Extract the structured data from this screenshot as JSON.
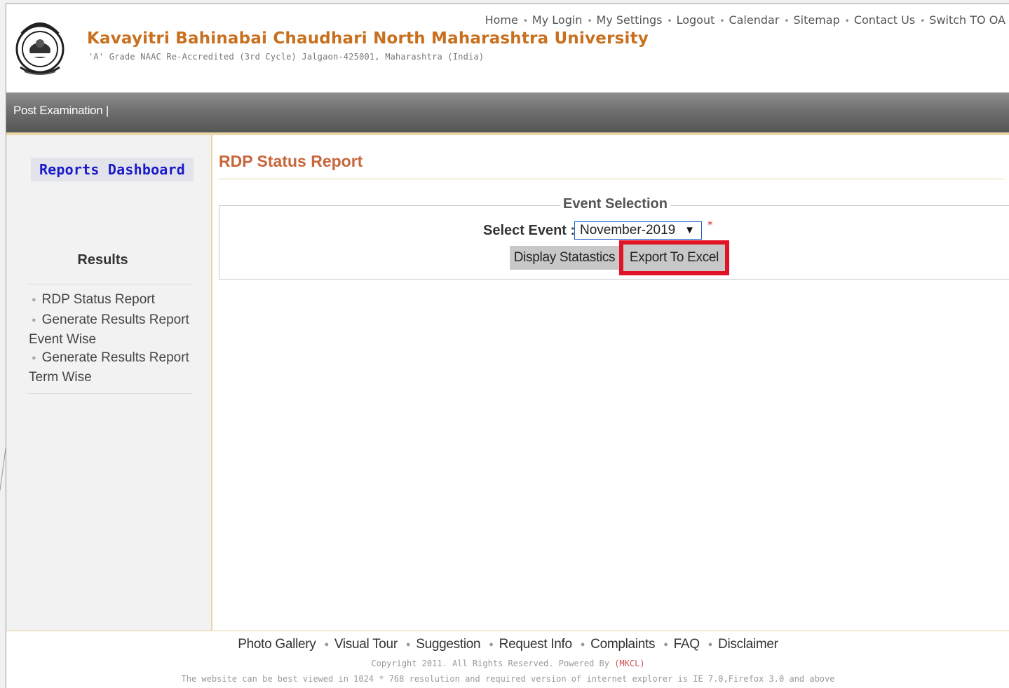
{
  "header": {
    "university_name": "Kavayitri Bahinabai Chaudhari North Maharashtra University",
    "subtitle": "'A' Grade NAAC Re-Accredited (3rd Cycle) Jalgaon-425001, Maharashtra (India)",
    "top_links": [
      "Home",
      "My Login",
      "My Settings",
      "Logout",
      "Calendar",
      "Sitemap",
      "Contact Us",
      "Switch TO OA"
    ],
    "logo_icon": "university-emblem-icon"
  },
  "nav": {
    "item": "Post Examination |"
  },
  "sidebar": {
    "dashboard_label": "Reports Dashboard",
    "section_title": "Results",
    "items": [
      {
        "label": "RDP Status Report"
      },
      {
        "label": "Generate Results Report Event Wise"
      },
      {
        "label": "Generate Results Report Term Wise"
      }
    ]
  },
  "main": {
    "title": "RDP Status Report",
    "legend": "Event Selection",
    "select_label": "Select Event :",
    "selected_event": "November-2019",
    "required_mark": "*",
    "display_button": "Display Statastics",
    "export_button": "Export To Excel"
  },
  "footer": {
    "links": [
      "Photo Gallery",
      "Visual Tour",
      "Suggestion",
      "Request Info",
      "Complaints",
      "FAQ",
      "Disclaimer"
    ],
    "copyright_prefix": "Copyright 2011. All Rights Reserved. Powered By ",
    "copyright_brand": "(MKCL)",
    "note": "The website can be best viewed in 1024 * 768 resolution and required version of internet explorer is IE 7.0,Firefox 3.0 and above"
  },
  "colors": {
    "university_name": "#c8701e",
    "page_title": "#c8653a",
    "dashboard_text": "#1a1ac8",
    "highlight_border": "#e01426",
    "nav_bar": "#6f6f6f"
  }
}
